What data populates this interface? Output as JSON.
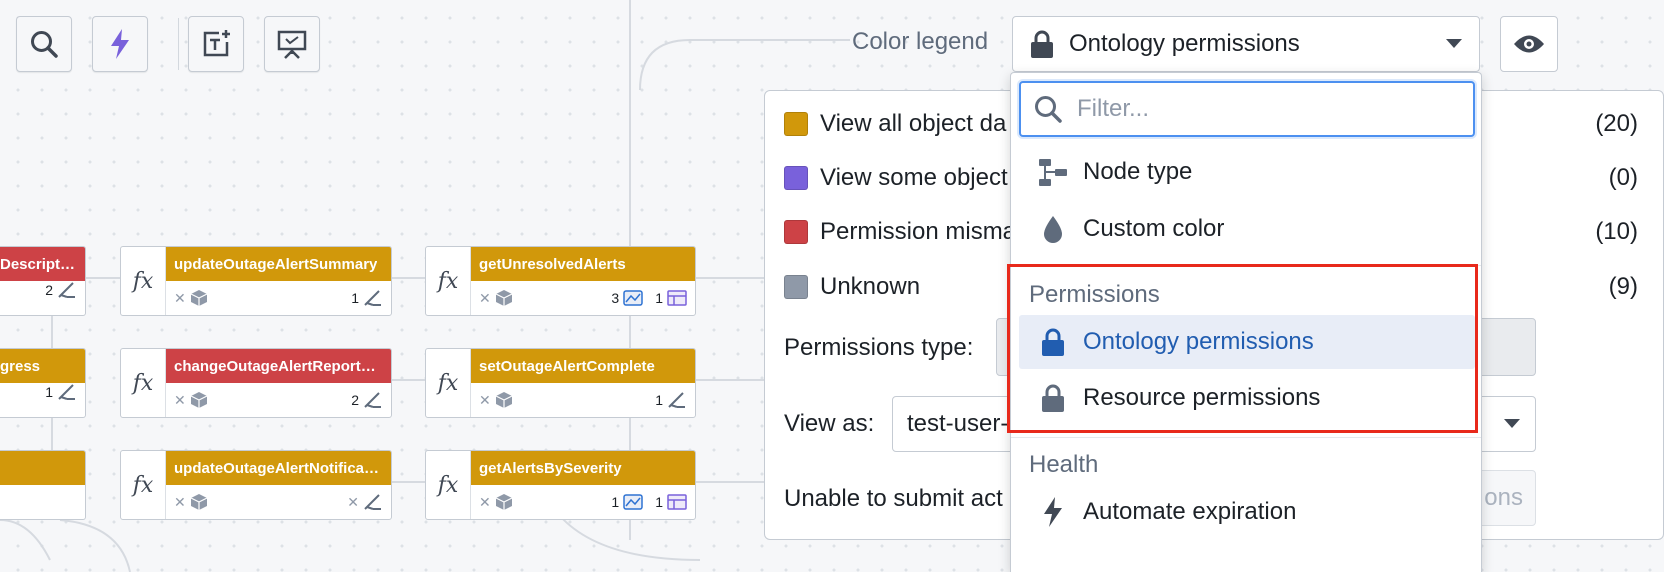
{
  "toolbar": {
    "buttons": [
      {
        "name": "search-tool",
        "icon": "search-icon"
      },
      {
        "name": "automate-tool",
        "icon": "lightning-icon"
      },
      {
        "name": "add-text-tool",
        "icon": "text-box-add-icon"
      },
      {
        "name": "presentation-tool",
        "icon": "presentation-icon"
      }
    ]
  },
  "graph": {
    "partial_nodes": [
      {
        "title": "Descriptio...",
        "count": "2",
        "color": "#cd4246"
      },
      {
        "title": "gress",
        "count": "1",
        "color": "#d1980b"
      },
      {
        "title": "",
        "count": "",
        "color": "#d1980b"
      }
    ],
    "nodes": [
      {
        "icon": "fx",
        "title": "updateOutageAlertSummary",
        "color": "gold",
        "count_a": "1",
        "count_b": ""
      },
      {
        "icon": "fx",
        "title": "getUnresolvedAlerts",
        "color": "gold",
        "count_a": "3",
        "count_b": "1"
      },
      {
        "icon": "fx",
        "title": "changeOutageAlertReportedB...",
        "color": "red",
        "count_a": "2",
        "count_b": ""
      },
      {
        "icon": "fx",
        "title": "setOutageAlertComplete",
        "color": "gold",
        "count_a": "1",
        "count_b": ""
      },
      {
        "icon": "fx",
        "title": "updateOutageAlertNotificatio...",
        "color": "gold",
        "count_a": "",
        "count_b": ""
      },
      {
        "icon": "fx",
        "title": "getAlertsBySeverity",
        "color": "gold",
        "count_a": "1",
        "count_b": "1"
      }
    ],
    "remove_glyph": "✕"
  },
  "legend": {
    "label": "Color legend",
    "selected": "Ontology permissions",
    "rows": [
      {
        "label": "View all object da",
        "count": "(20)",
        "color": "#d1980b"
      },
      {
        "label": "View some object",
        "count": "(0)",
        "color": "#7961db"
      },
      {
        "label": "Permission misma",
        "count": "(10)",
        "color": "#cd4246"
      },
      {
        "label": "Unknown",
        "count": "(9)",
        "color": "#8f99a8"
      }
    ],
    "permissions_type_label": "Permissions type:",
    "view_as_label": "View as:",
    "view_as_value": "test-user-",
    "unable_label": "Unable to submit act",
    "unable_button": "ons"
  },
  "dropdown": {
    "filter_placeholder": "Filter...",
    "items": [
      {
        "label": "Node type",
        "icon": "node-type-icon"
      },
      {
        "label": "Custom color",
        "icon": "droplet-icon"
      }
    ],
    "permissions_header": "Permissions",
    "permissions_items": [
      {
        "label": "Ontology permissions",
        "icon": "lock-icon",
        "active": true
      },
      {
        "label": "Resource permissions",
        "icon": "lock-icon",
        "active": false
      }
    ],
    "health_header": "Health",
    "health_items": [
      {
        "label": "Automate expiration",
        "icon": "lightning-icon"
      }
    ]
  },
  "colors": {
    "accent": "#215db0",
    "gold": "#d1980b",
    "red": "#cd4246",
    "highlight": "#e8291b"
  }
}
